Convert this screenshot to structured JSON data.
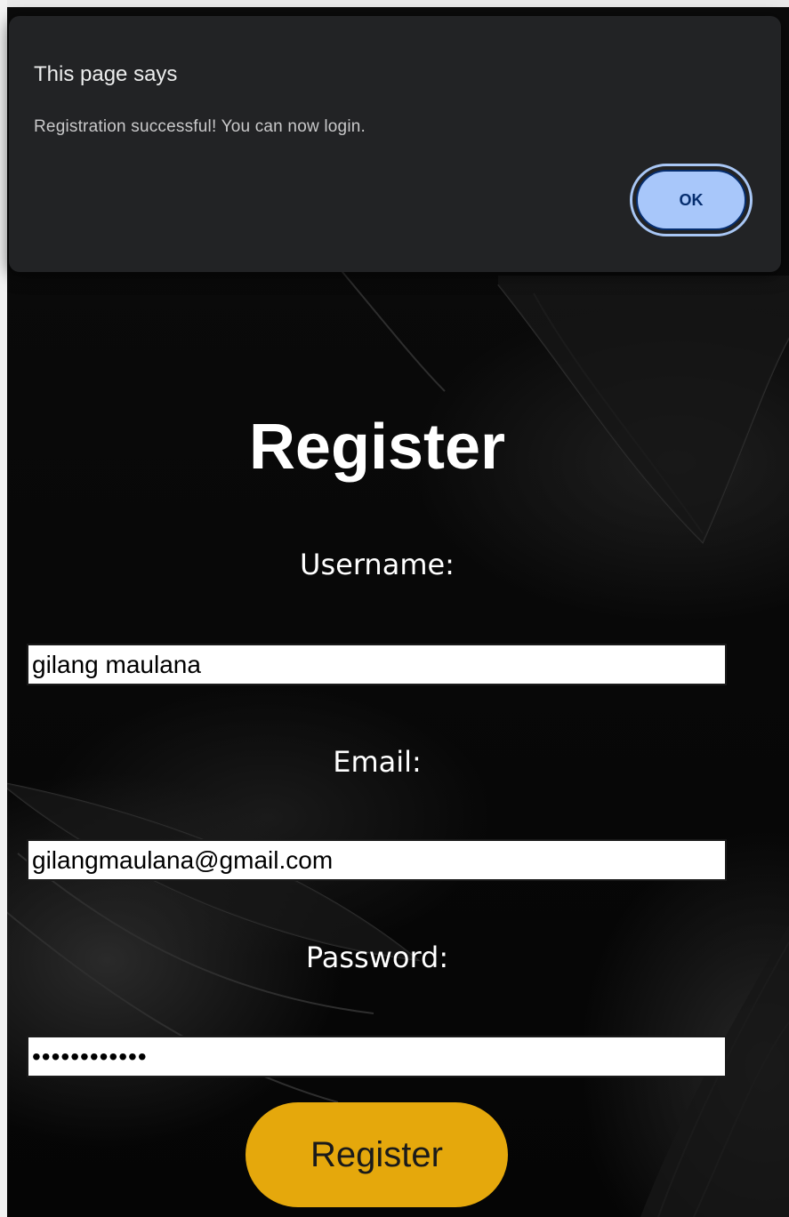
{
  "dialog": {
    "title": "This page says",
    "message": "Registration successful! You can now login.",
    "ok_label": "OK"
  },
  "form": {
    "title": "Register",
    "username_label": "Username:",
    "username_value": "gilang maulana",
    "email_label": "Email:",
    "email_value": "gilangmaulana@gmail.com",
    "password_label": "Password:",
    "password_value": "••••••••••••",
    "submit_label": "Register"
  },
  "colors": {
    "dialog_bg": "#222325",
    "ok_button": "#a8c7fa",
    "register_button": "#e5a80c",
    "page_bg": "#0b0b0b"
  }
}
